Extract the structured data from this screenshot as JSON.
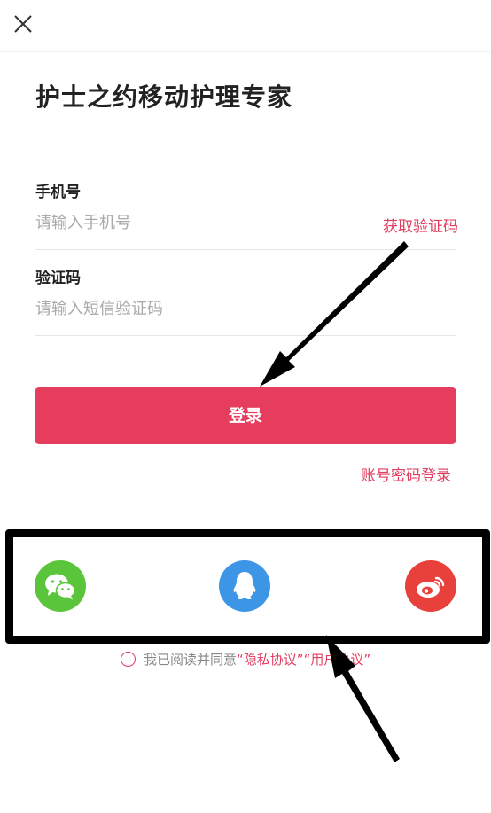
{
  "header": {
    "close_icon": "close-icon"
  },
  "title": "护士之约移动护理专家",
  "phone": {
    "label": "手机号",
    "placeholder": "请输入手机号",
    "get_code": "获取验证码"
  },
  "code": {
    "label": "验证码",
    "placeholder": "请输入短信验证码"
  },
  "login_button": "登录",
  "password_login": "账号密码登录",
  "social": [
    {
      "name": "wechat-icon",
      "color": "#5ac53a"
    },
    {
      "name": "qq-icon",
      "color": "#3d95e6"
    },
    {
      "name": "weibo-icon",
      "color": "#e8413c"
    }
  ],
  "agreement": {
    "prefix": "我已阅读并同意",
    "privacy": "“隐私协议”",
    "user": "“用户协议”"
  },
  "colors": {
    "accent": "#e63d5f",
    "annotation": "#000000"
  }
}
